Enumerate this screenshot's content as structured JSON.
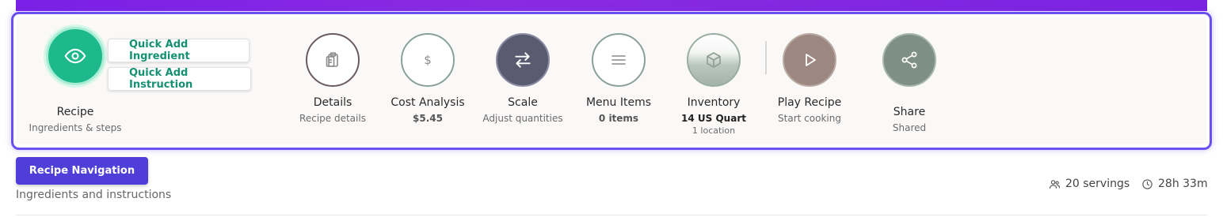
{
  "quick_add": {
    "ingredient": "Quick Add Ingredient",
    "instruction": "Quick Add Instruction"
  },
  "recipe": {
    "label": "Recipe",
    "sub": "Ingredients & steps",
    "icon": "eye-icon"
  },
  "actions": {
    "details": {
      "label": "Details",
      "sub": "Recipe details",
      "icon": "clipboard-icon"
    },
    "cost": {
      "label": "Cost Analysis",
      "sub": "$5.45",
      "icon": "dollar-icon"
    },
    "scale": {
      "label": "Scale",
      "sub": "Adjust quantities",
      "icon": "swap-arrows-icon"
    },
    "menu": {
      "label": "Menu Items",
      "sub": "0 items",
      "icon": "menu-lines-icon"
    },
    "inventory": {
      "label": "Inventory",
      "sub": "14 US Quart",
      "tiny": "1 location",
      "icon": "box-icon"
    },
    "play": {
      "label": "Play Recipe",
      "sub": "Start cooking",
      "icon": "play-icon"
    },
    "share": {
      "label": "Share",
      "sub": "Shared",
      "icon": "share-icon"
    }
  },
  "navigation": {
    "button": "Recipe Navigation",
    "description": "Ingredients and instructions"
  },
  "meta": {
    "servings": "20 servings",
    "time": "28h 33m"
  },
  "colors": {
    "accent": "#1db98c",
    "nav": "#4f3fd8",
    "border": "#6b4ff0",
    "topbar": "#8a2be2"
  }
}
